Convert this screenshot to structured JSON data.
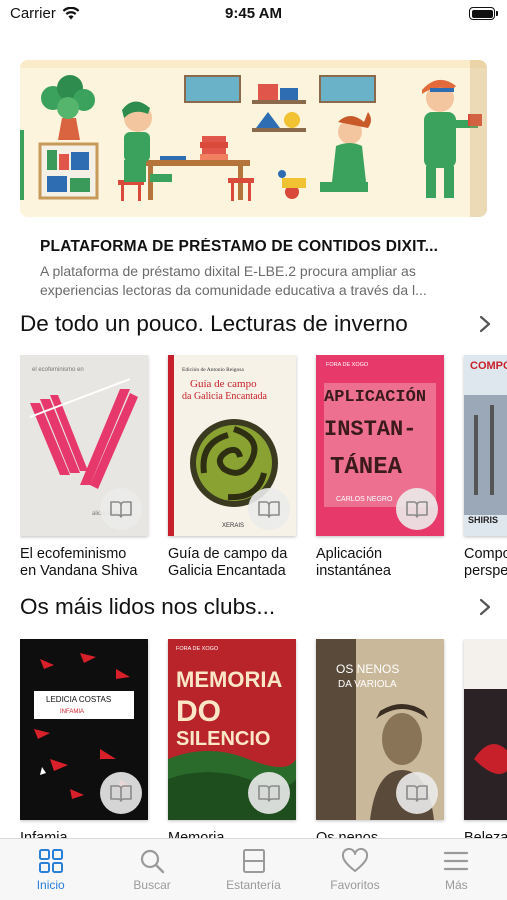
{
  "status_bar": {
    "carrier": "Carrier",
    "time": "9:45 AM"
  },
  "feature": {
    "title": "PLATAFORMA DE PRÉSTAMO DE CONTIDOS DIXIT...",
    "description_lines": [
      "A plataforma de préstamo dixital E-LBE.2 procura ampliar as",
      "experiencias lectoras da comunidade educativa a través da l..."
    ]
  },
  "sections": [
    {
      "title": "De todo un pouco. Lecturas de inverno",
      "books": [
        {
          "title": "El ecofeminismo\nen Vandana Shiva",
          "cover_text": [
            "el ecofeminismo en",
            "alicia lópez"
          ]
        },
        {
          "title": "Guía de campo da\nGalicia Encantada",
          "cover_text": [
            "Edición de Antonio Reigosa",
            "Guía de campo",
            "da Galicia Encantada",
            "XERAIS"
          ]
        },
        {
          "title": "Aplicación\ninstantánea",
          "cover_text": [
            "FORA DE XOGO",
            "APLICACIÓN",
            "INSTAN-",
            "TÁNEA",
            "CARLOS NEGRO"
          ]
        },
        {
          "title": "Compo\nperspe",
          "cover_text": [
            "COMPOSI",
            "SHIRIS"
          ]
        }
      ]
    },
    {
      "title": "Os máis lidos nos clubs...",
      "books": [
        {
          "title": "Infamia",
          "cover_text": [
            "LEDICIA COSTAS",
            "INFAMIA"
          ]
        },
        {
          "title": "Memoria",
          "cover_text": [
            "FORA DE XOGO",
            "MEMORIA",
            "DO",
            "SILENCIO"
          ]
        },
        {
          "title": "Os nenos",
          "cover_text": [
            "OS NENOS",
            "DA VARIOLA"
          ]
        },
        {
          "title": "Beleza",
          "cover_text": []
        }
      ]
    }
  ],
  "tabs": [
    {
      "label": "Inicio",
      "icon": "grid-icon",
      "active": true
    },
    {
      "label": "Buscar",
      "icon": "search-icon",
      "active": false
    },
    {
      "label": "Estantería",
      "icon": "shelf-icon",
      "active": false
    },
    {
      "label": "Favoritos",
      "icon": "heart-icon",
      "active": false
    },
    {
      "label": "Más",
      "icon": "menu-icon",
      "active": false
    }
  ],
  "colors": {
    "accent": "#2a7fd8",
    "inactive": "#9a9a9a"
  }
}
